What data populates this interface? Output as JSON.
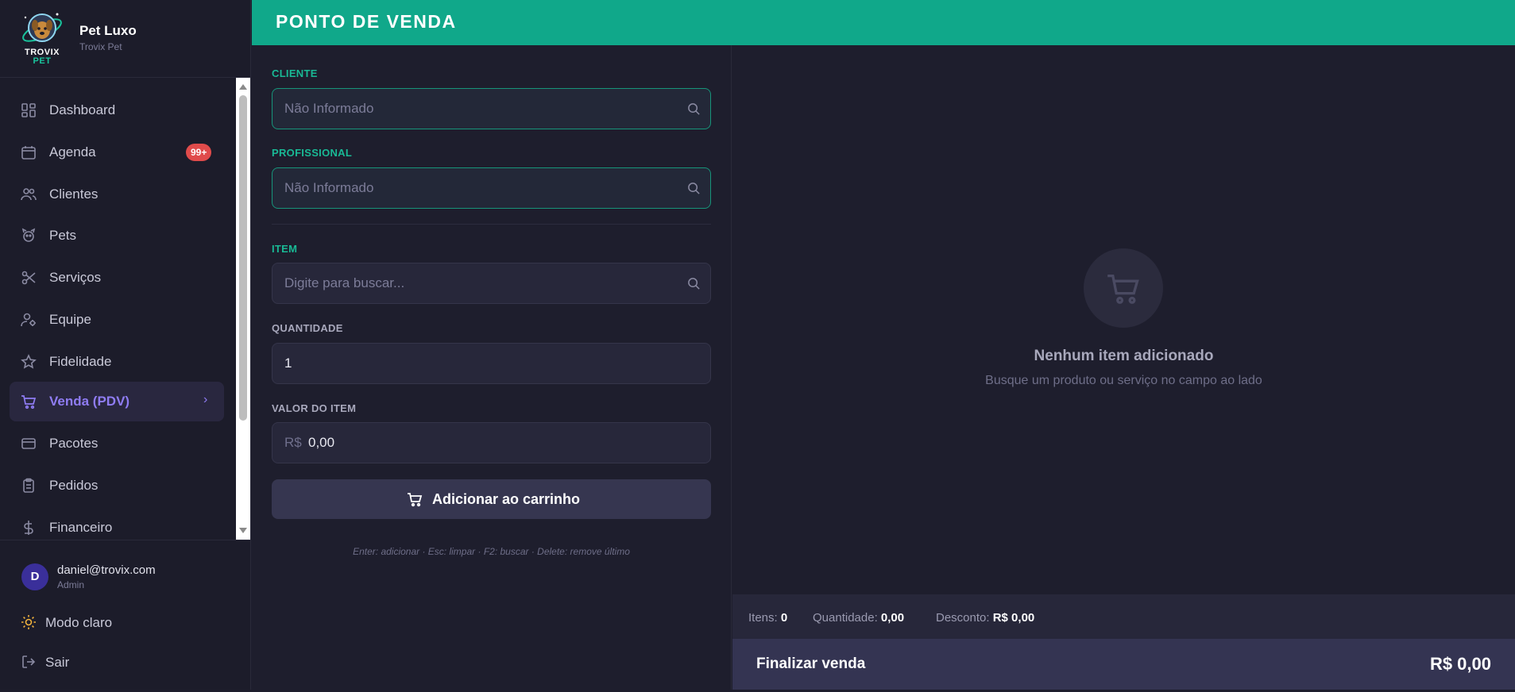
{
  "brand": {
    "logo_line1": "TROVIX",
    "logo_line2": "PET",
    "name": "Pet Luxo",
    "subtitle": "Trovix Pet"
  },
  "sidebar": {
    "items": [
      {
        "label": "Dashboard",
        "icon": "dashboard-icon"
      },
      {
        "label": "Agenda",
        "icon": "calendar-icon",
        "badge": "99+"
      },
      {
        "label": "Clientes",
        "icon": "users-icon"
      },
      {
        "label": "Pets",
        "icon": "paw-icon"
      },
      {
        "label": "Serviços",
        "icon": "scissors-icon"
      },
      {
        "label": "Equipe",
        "icon": "team-icon"
      },
      {
        "label": "Fidelidade",
        "icon": "star-icon"
      },
      {
        "label": "Venda (PDV)",
        "icon": "cart-icon",
        "active": true,
        "chevron": "›"
      },
      {
        "label": "Pacotes",
        "icon": "card-icon"
      },
      {
        "label": "Pedidos",
        "icon": "clipboard-icon"
      },
      {
        "label": "Financeiro",
        "icon": "dollar-icon"
      }
    ]
  },
  "user": {
    "initial": "D",
    "email": "daniel@trovix.com",
    "role": "Admin"
  },
  "footer": {
    "theme_label": "Modo claro",
    "logout_label": "Sair"
  },
  "header": {
    "title": "PONTO DE VENDA"
  },
  "form": {
    "cliente": {
      "label": "CLIENTE",
      "placeholder": "Não Informado"
    },
    "profissional": {
      "label": "PROFISSIONAL",
      "placeholder": "Não Informado"
    },
    "item": {
      "label": "ITEM",
      "placeholder": "Digite para buscar..."
    },
    "quantidade": {
      "label": "QUANTIDADE",
      "value": "1"
    },
    "valor": {
      "label": "VALOR DO ITEM",
      "currency": "R$",
      "value": "0,00"
    },
    "add_button": "Adicionar ao carrinho",
    "shortcuts": "Enter: adicionar · Esc: limpar · F2: buscar · Delete: remove último"
  },
  "cart": {
    "empty_title": "Nenhum item adicionado",
    "empty_subtitle": "Busque um produto ou serviço no campo ao lado"
  },
  "summary": {
    "itens_label": "Itens:",
    "itens_value": "0",
    "quantidade_label": "Quantidade:",
    "quantidade_value": "0,00",
    "desconto_label": "Desconto:",
    "desconto_value": "R$ 0,00"
  },
  "finalize": {
    "label": "Finalizar venda",
    "total": "R$ 0,00"
  },
  "colors": {
    "accent_teal": "#10a88a",
    "active_purple": "#8f7cf3",
    "badge_red": "#e04b4b",
    "background": "#1e1e2d"
  }
}
